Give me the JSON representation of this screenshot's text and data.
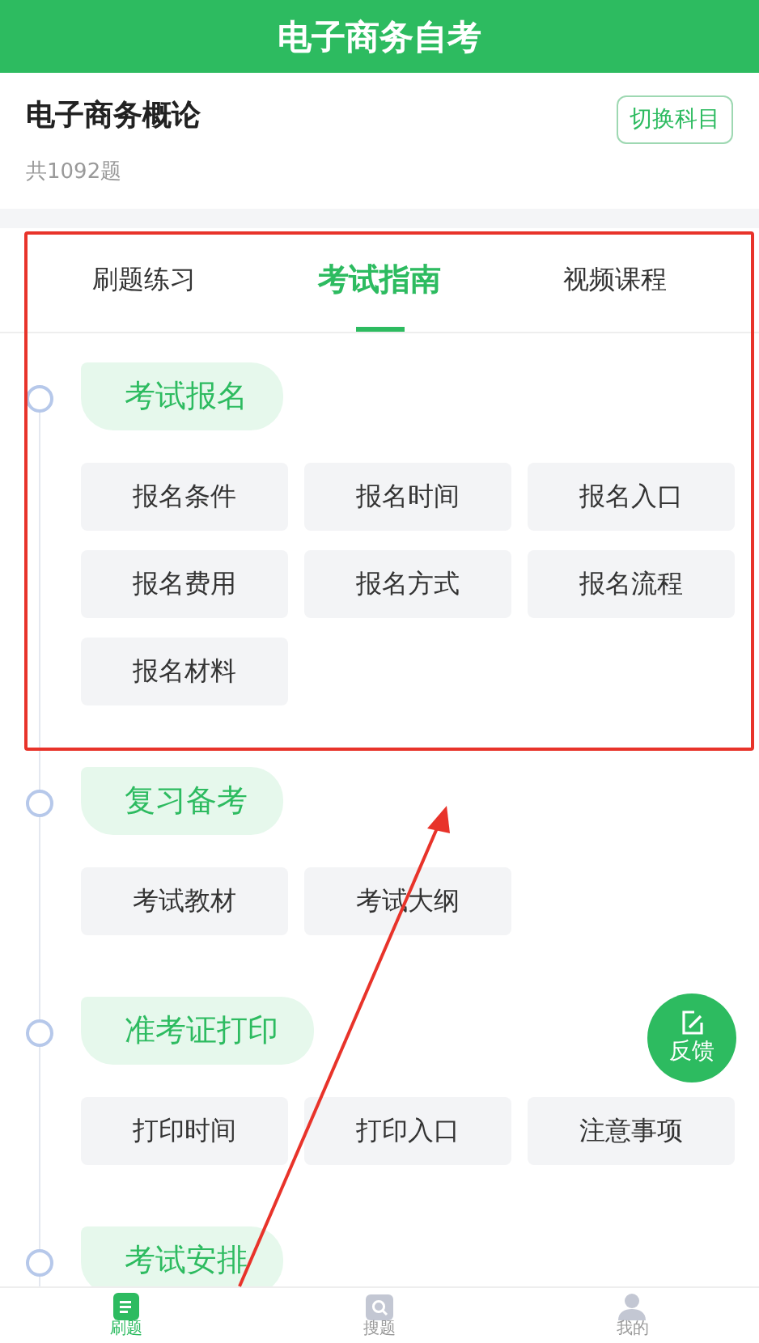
{
  "header": {
    "title": "电子商务自考"
  },
  "subject": {
    "name": "电子商务概论",
    "count": "共1092题",
    "switch_button": "切换科目"
  },
  "tabs": [
    {
      "label": "刷题练习",
      "selected": false
    },
    {
      "label": "考试指南",
      "selected": true
    },
    {
      "label": "视频课程",
      "selected": false
    }
  ],
  "sections": [
    {
      "title": "考试报名",
      "items": [
        "报名条件",
        "报名时间",
        "报名入口",
        "报名费用",
        "报名方式",
        "报名流程",
        "报名材料"
      ]
    },
    {
      "title": "复习备考",
      "items": [
        "考试教材",
        "考试大纲"
      ]
    },
    {
      "title": "准考证打印",
      "items": [
        "打印时间",
        "打印入口",
        "注意事项"
      ]
    },
    {
      "title": "考试安排"
    }
  ],
  "feedback_button": "反馈",
  "bottom_nav": [
    {
      "label": "刷题",
      "kind": "document",
      "selected": true
    },
    {
      "label": "搜题",
      "kind": "search",
      "selected": false
    },
    {
      "label": "我的",
      "kind": "person",
      "selected": false
    }
  ]
}
